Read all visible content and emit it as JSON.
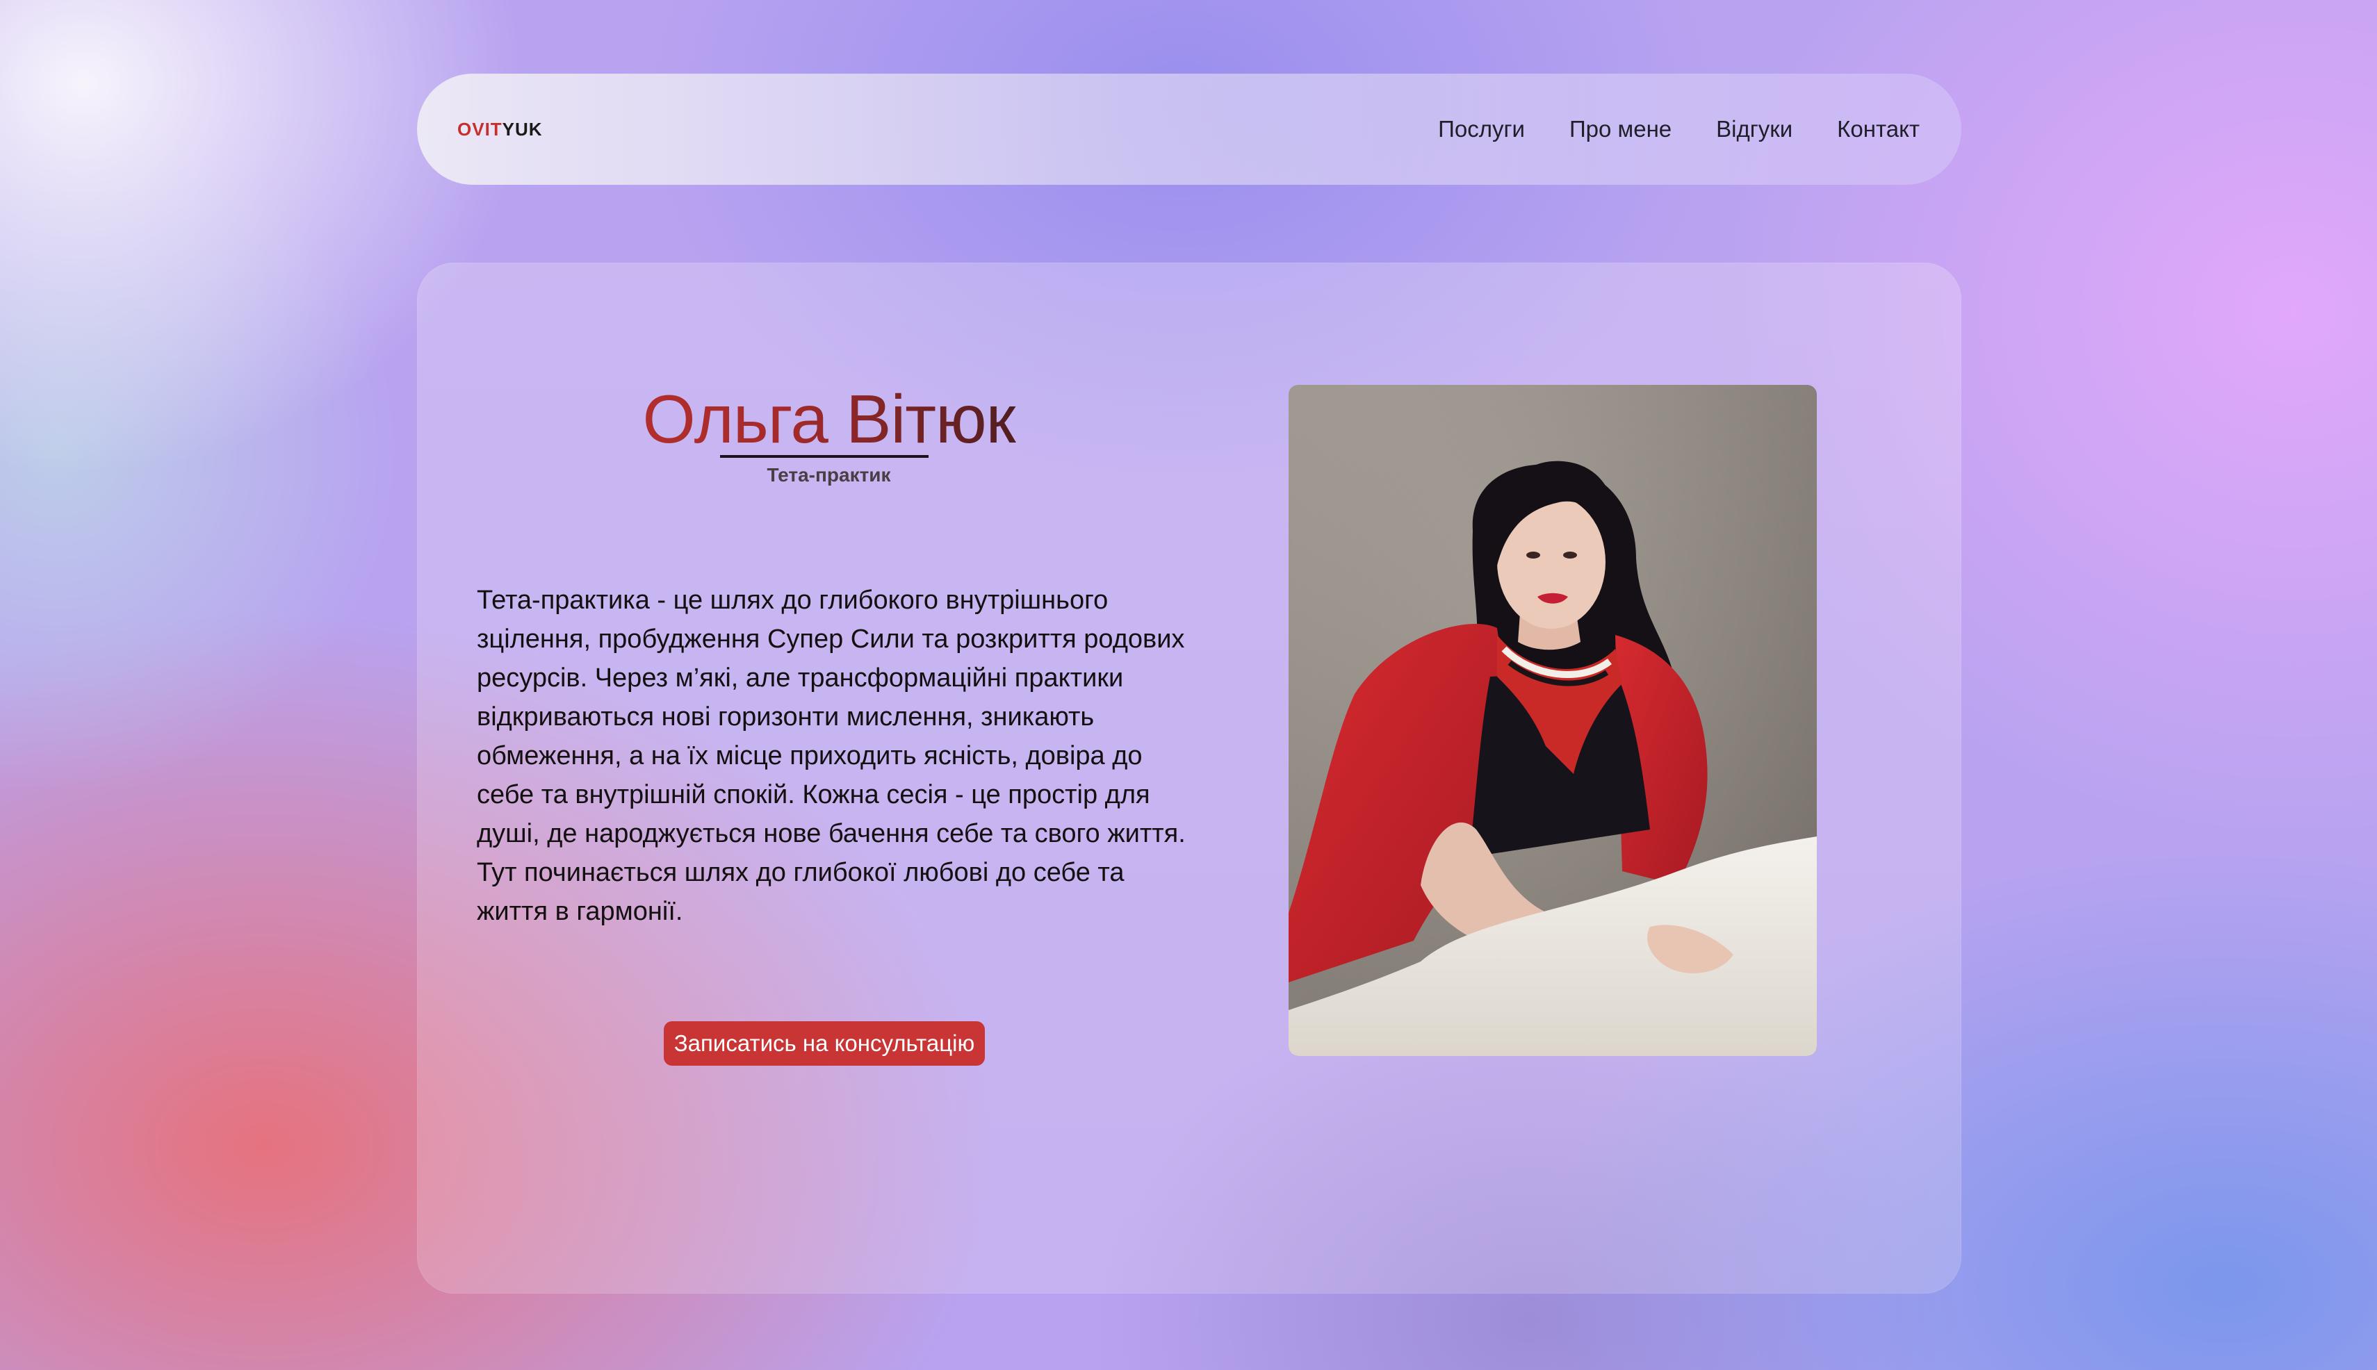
{
  "nav": {
    "logo_part1": "OVIT",
    "logo_part2": "YUK",
    "links": [
      {
        "label": "Послуги"
      },
      {
        "label": "Про мене"
      },
      {
        "label": "Відгуки"
      },
      {
        "label": "Контакт"
      }
    ]
  },
  "hero": {
    "name": "Ольга Вітюк",
    "subtitle": "Тета-практик",
    "description": "Тета-практика - це шлях до глибокого внутрішнього зцілення, пробудження Супер Сили та розкриття родових ресурсів. Через м’які, але трансформаційні практики відкриваються нові горизонти мислення, зникають обмеження, а на їх місце приходить ясність, довіра до себе та внутрішній спокій. Кожна сесія - це простір для душі, де народжується нове бачення себе та свого життя. Тут починається шлях до глибокої любові до себе та життя в гармонії.",
    "cta_label": "Записатись на консультацію"
  },
  "colors": {
    "accent": "#c93434",
    "text": "#141012"
  }
}
